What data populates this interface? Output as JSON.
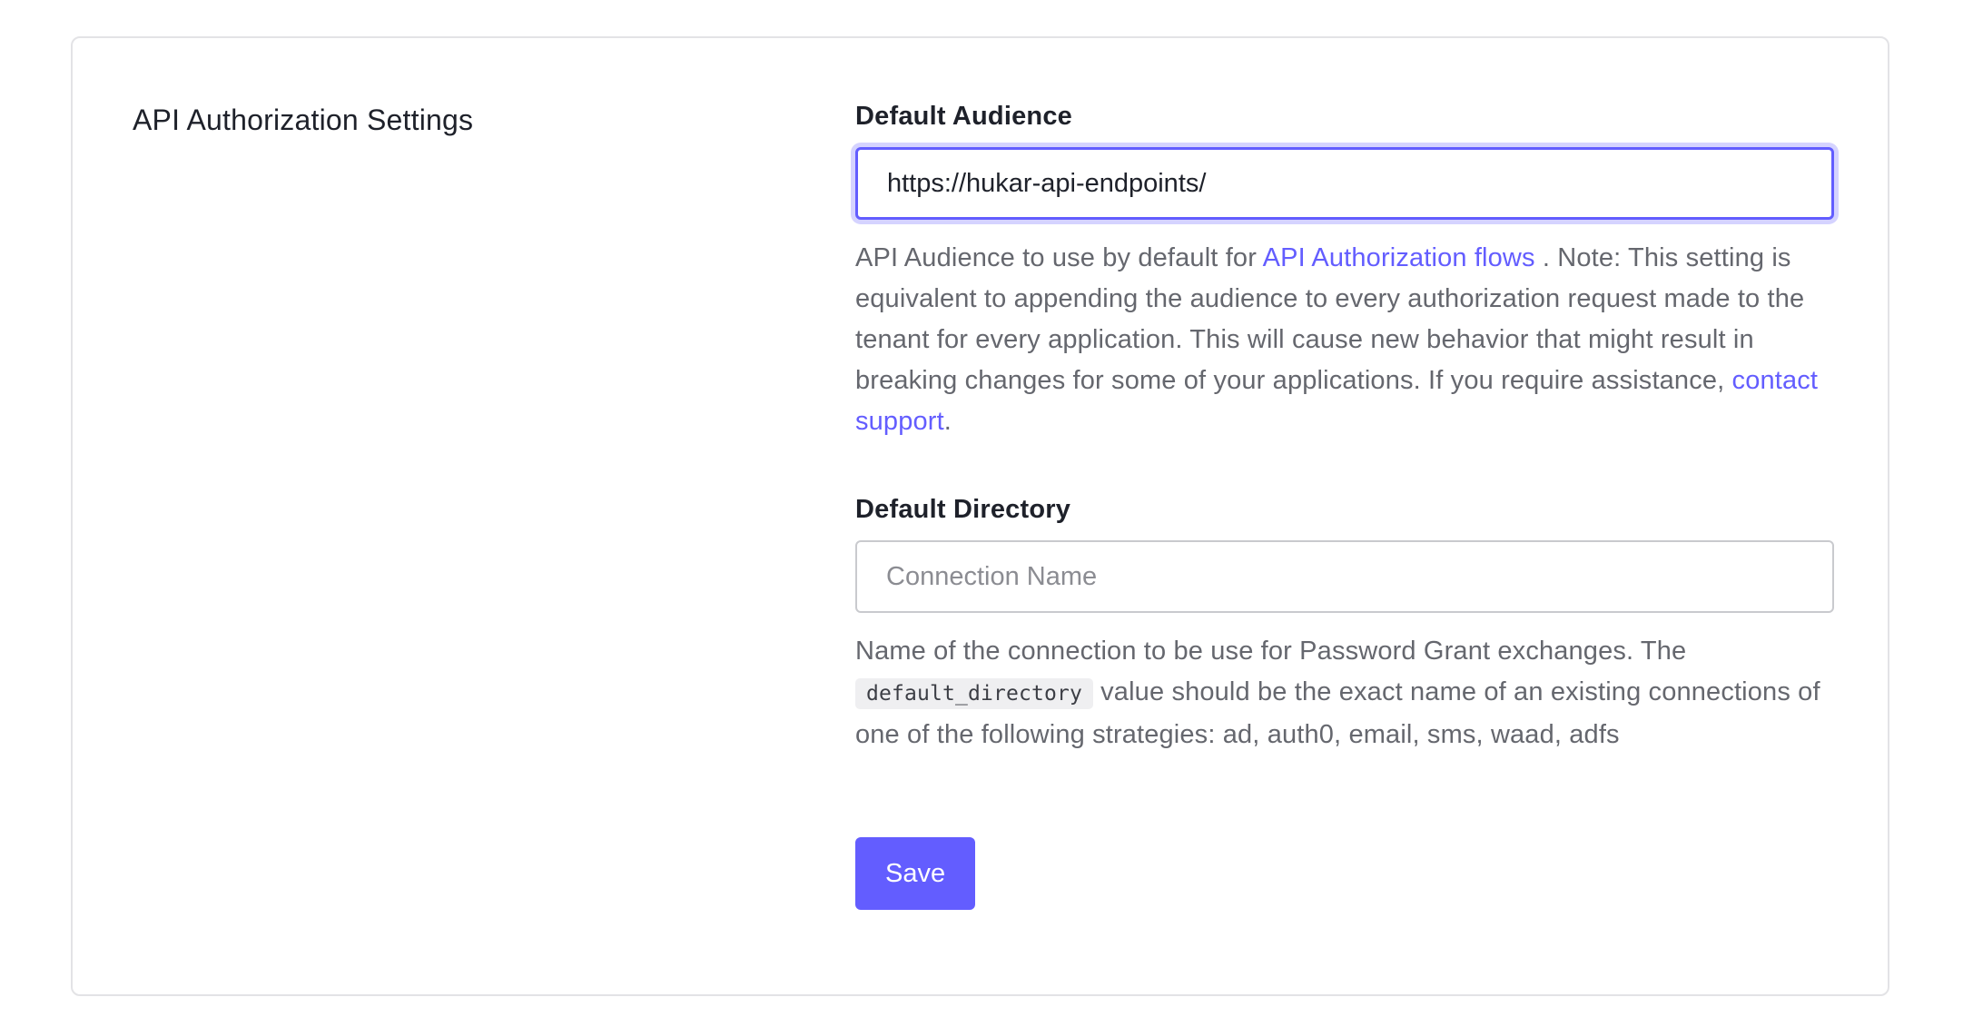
{
  "section": {
    "title": "API Authorization Settings"
  },
  "default_audience": {
    "label": "Default Audience",
    "value": "https://hukar-api-endpoints/",
    "placeholder": "",
    "help_prefix": "API Audience to use by default for ",
    "help_link": "API Authorization flows",
    "help_middle": " . Note: This setting is equivalent to appending the audience to every authorization request made to the tenant for every application. This will cause new behavior that might result in breaking changes for some of your applications. If you require assistance, ",
    "support_link": "contact support",
    "help_suffix": "."
  },
  "default_directory": {
    "label": "Default Directory",
    "value": "",
    "placeholder": "Connection Name",
    "help_prefix": "Name of the connection to be use for Password Grant exchanges. The ",
    "help_code": "default_directory",
    "help_suffix": " value should be the exact name of an existing connections of one of the following strategies: ad, auth0, email, sms, waad, adfs"
  },
  "actions": {
    "save_label": "Save"
  },
  "colors": {
    "accent": "#635dff",
    "border": "#c9cace",
    "help_text": "#65676e"
  }
}
